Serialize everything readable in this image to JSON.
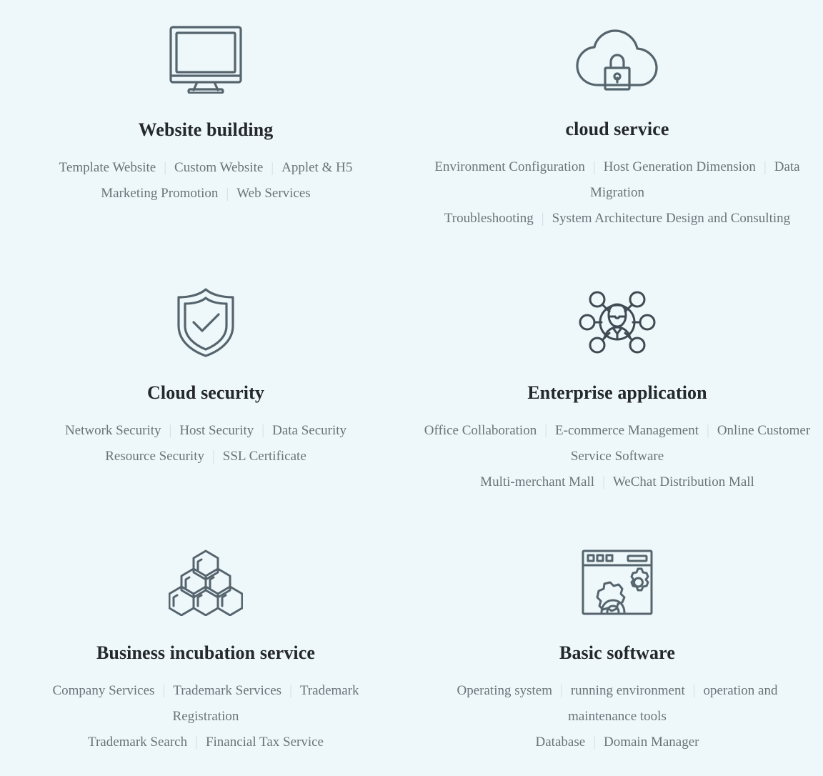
{
  "page": {
    "background_color": "#eef8fb",
    "title_color": "#25282a",
    "link_color": "#6b7378",
    "separator_color": "#cfdee4",
    "icon_color": "#56656d",
    "separator_glyph": "|"
  },
  "sections": [
    {
      "icon": "monitor-icon",
      "title": "Website building",
      "link_rows": [
        [
          "Template Website",
          "Custom Website",
          "Applet & H5"
        ],
        [
          "Marketing Promotion",
          "Web Services"
        ]
      ]
    },
    {
      "icon": "cloud-lock-icon",
      "title": "cloud service",
      "link_rows": [
        [
          "Environment Configuration",
          "Host Generation Dimension",
          "Data Migration"
        ],
        [
          "Troubleshooting",
          "System Architecture Design and Consulting"
        ]
      ]
    },
    {
      "icon": "shield-check-icon",
      "title": "Cloud security",
      "link_rows": [
        [
          "Network Security",
          "Host Security",
          "Data Security"
        ],
        [
          "Resource Security",
          "SSL Certificate"
        ]
      ]
    },
    {
      "icon": "network-person-icon",
      "title": "Enterprise application",
      "link_rows": [
        [
          "Office Collaboration",
          "E-commerce Management",
          "Online Customer Service Software"
        ],
        [
          "Multi-merchant Mall",
          "WeChat Distribution Mall"
        ]
      ]
    },
    {
      "icon": "hexagon-cluster-icon",
      "title": "Business incubation service",
      "link_rows": [
        [
          "Company Services",
          "Trademark Services",
          "Trademark Registration"
        ],
        [
          "Trademark Search",
          "Financial Tax Service"
        ]
      ]
    },
    {
      "icon": "browser-gears-icon",
      "title": "Basic software",
      "link_rows": [
        [
          "Operating system",
          "running environment",
          "operation and maintenance tools"
        ],
        [
          "Database",
          "Domain Manager"
        ]
      ]
    }
  ]
}
